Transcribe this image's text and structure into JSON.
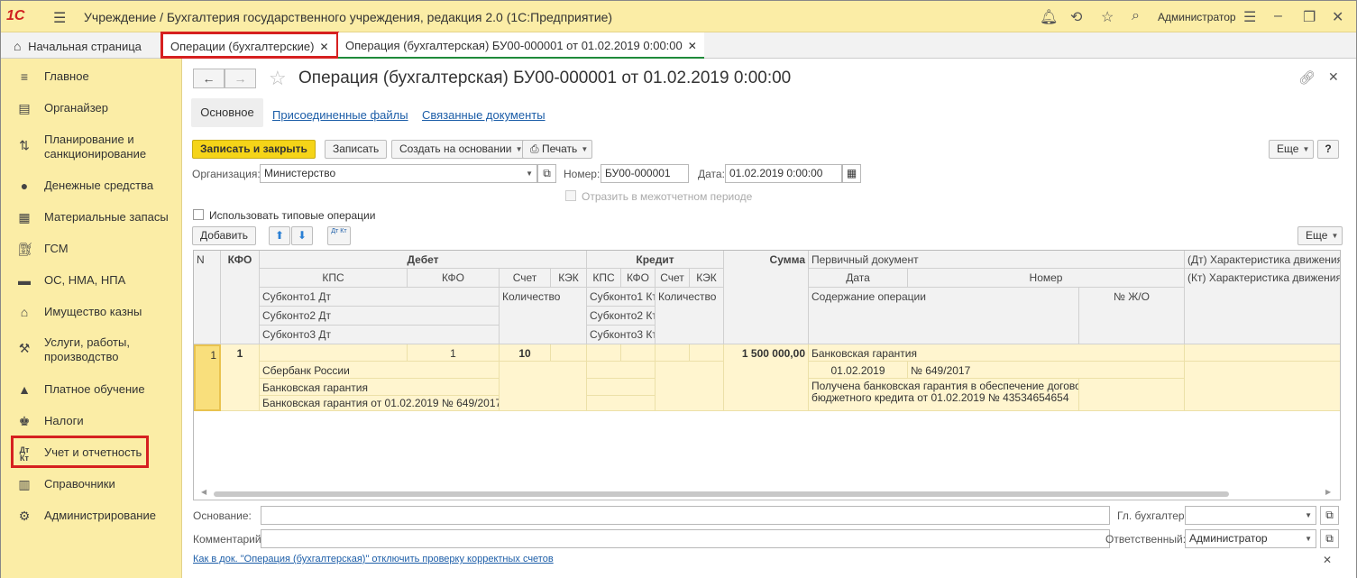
{
  "app": {
    "logo": "1С",
    "title": "Учреждение / Бухгалтерия государственного учреждения, редакция 2.0  (1С:Предприятие)",
    "user": "Администратор"
  },
  "tabs": [
    {
      "label": "Начальная страница"
    },
    {
      "label": "Операции (бухгалтерские)"
    },
    {
      "label": "Операция (бухгалтерская) БУ00-000001 от 01.02.2019 0:00:00"
    }
  ],
  "sidebar": {
    "items": [
      {
        "label": "Главное",
        "icon": "menu-icon"
      },
      {
        "label": "Органайзер",
        "icon": "organizer-icon"
      },
      {
        "label": "Планирование и санкционирование",
        "icon": "planning-icon"
      },
      {
        "label": "Денежные средства",
        "icon": "money-icon"
      },
      {
        "label": "Материальные запасы",
        "icon": "inventory-icon"
      },
      {
        "label": "ГСМ",
        "icon": "fuel-icon"
      },
      {
        "label": "ОС, НМА, НПА",
        "icon": "truck-icon"
      },
      {
        "label": "Имущество казны",
        "icon": "treasury-icon"
      },
      {
        "label": "Услуги, работы, производство",
        "icon": "services-icon"
      },
      {
        "label": "Платное обучение",
        "icon": "education-icon"
      },
      {
        "label": "Налоги",
        "icon": "taxes-icon"
      },
      {
        "label": "Учет и отчетность",
        "icon": "accounting-icon"
      },
      {
        "label": "Справочники",
        "icon": "reference-icon"
      },
      {
        "label": "Администрирование",
        "icon": "gear-icon"
      }
    ]
  },
  "form": {
    "title": "Операция (бухгалтерская) БУ00-000001 от 01.02.2019 0:00:00",
    "subtabs": [
      "Основное",
      "Присоединенные файлы",
      "Связанные документы"
    ],
    "toolbar": {
      "save_close": "Записать и закрыть",
      "save": "Записать",
      "create_based": "Создать на основании",
      "print": "Печать",
      "more": "Еще",
      "help": "?"
    },
    "org_label": "Организация:",
    "org_value": "Министерство",
    "num_label": "Номер:",
    "num_value": "БУ00-000001",
    "date_label": "Дата:",
    "date_value": "01.02.2019  0:00:00",
    "interperiod": "Отразить в межотчетном периоде",
    "typical_ops": "Использовать типовые операции",
    "add": "Добавить",
    "dtkt": "Дт Кт"
  },
  "grid": {
    "headers": {
      "n": "N",
      "kfo": "КФО",
      "debit": "Дебет",
      "credit": "Кредит",
      "sum": "Сумма",
      "primary_doc": "Первичный документ",
      "dt_char": "(Дт) Характеристика движения",
      "kt_char": "(Кт) Характеристика движения",
      "kps": "КПС",
      "kfo2": "КФО",
      "account": "Счет",
      "kek": "КЭК",
      "kps_c": "КПС",
      "kfo_c": "КФО",
      "account_c": "Счет",
      "kek_c": "КЭК",
      "date": "Дата",
      "number": "Номер",
      "sub1_dt": "Субконто1 Дт",
      "sub2_dt": "Субконто2 Дт",
      "sub3_dt": "Субконто3 Дт",
      "qty": "Количество",
      "sub1_kt": "Субконто1 Кт",
      "sub2_kt": "Субконто2 Кт",
      "sub3_kt": "Субконто3 Кт",
      "qty_c": "Количество",
      "content": "Содержание операции",
      "journal": "№ Ж/О"
    },
    "row": {
      "n": "1",
      "kfo": "1",
      "debit_kfo": "1",
      "debit_account": "10",
      "sum": "1 500 000,00",
      "primary_doc": "Банковская гарантия",
      "doc_date": "01.02.2019",
      "doc_number": "№ 649/2017",
      "sub1": "Сбербанк России",
      "sub2": "Банковская гарантия",
      "sub3": "Банковская гарантия от 01.02.2019 № 649/2017",
      "content_1": "Получена банковская гарантия в обеспечение договора",
      "content_2": "бюджетного кредита от 01.02.2019 № 43534654654"
    }
  },
  "footer": {
    "basis_label": "Основание:",
    "basis_value": "",
    "chief_label": "Гл. бухгалтер:",
    "chief_value": "",
    "comment_label": "Комментарий:",
    "comment_value": "",
    "resp_label": "Ответственный:",
    "resp_value": "Администратор",
    "help_link": "Как в док. \"Операция (бухгалтерская)\" отключить проверку корректных счетов"
  },
  "colors": {
    "accent": "#fbeda6",
    "highlight": "#d62020",
    "primary_button": "#f5d418",
    "link": "#1d5ea8"
  }
}
